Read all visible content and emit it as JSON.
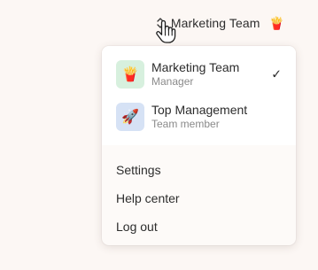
{
  "header": {
    "team_label": "Marketing Team",
    "team_emoji": "🍟"
  },
  "dropdown": {
    "teams": [
      {
        "name": "Marketing Team",
        "role": "Manager",
        "emoji": "🍟",
        "avatar_color": "#d7f0de",
        "selected": true,
        "check": "✓"
      },
      {
        "name": "Top Management",
        "role": "Team member",
        "emoji": "🚀",
        "avatar_color": "#d6e2f5",
        "selected": false
      }
    ],
    "menu": [
      {
        "label": "Settings"
      },
      {
        "label": "Help center"
      },
      {
        "label": "Log out"
      }
    ]
  },
  "colors": {
    "background": "#fcf7f4",
    "panel": "#fdfaf8",
    "team_section": "#ffffff",
    "text": "#2d2d2d",
    "muted_text": "#8a8a8a"
  },
  "icons": {
    "trigger_chevron": "chevron-up-down-icon",
    "cursor": "pointer-hand-icon",
    "check": "checkmark-icon"
  }
}
